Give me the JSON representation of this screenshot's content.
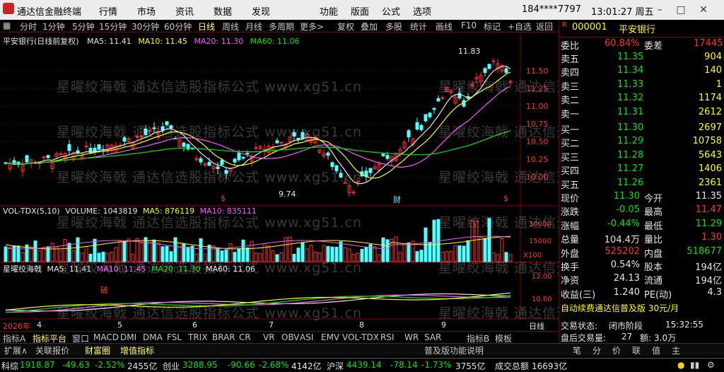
{
  "titlebar": {
    "app_name": "通达信金融终端",
    "menus": [
      "行情",
      "市场",
      "资讯",
      "数据",
      "发现",
      "功能",
      "版面",
      "公式",
      "选项"
    ],
    "user": "184****7797",
    "clock": "13:01:27 周五"
  },
  "toolbar": {
    "periods": [
      "分时",
      "1分钟",
      "5分钟",
      "15分钟",
      "30分钟",
      "60分钟",
      "日线",
      "周线",
      "月线",
      "多周期",
      "更多>"
    ],
    "active_period": "日线",
    "tools": [
      "复权",
      "叠加",
      "多股",
      "统计",
      "画线",
      "F10",
      "标记",
      "+自选",
      "返回"
    ]
  },
  "main_chart": {
    "label": "平安银行(日线前复权)",
    "ma_labels": [
      "MA5: 11.41",
      "MA10: 11.45",
      "MA20: 11.30",
      "MA60: 11.06"
    ],
    "ma_colors": [
      "#e6e6e6",
      "#ffff00",
      "#ff54ff",
      "#00e600"
    ],
    "price_ticks": [
      "11.50",
      "11.25",
      "11.00",
      "10.75",
      "10.50",
      "10.25",
      "10.00"
    ],
    "high_label": "11.83",
    "low_label": "9.74",
    "event_marks": [
      "$",
      "财",
      "$"
    ]
  },
  "volume_chart": {
    "label": "VOL-TDX(5,10)",
    "values": [
      "VOLUME: 1043819",
      "MA5: 876119",
      "MA10: 835111"
    ],
    "ticks": [
      "30000",
      "15000",
      "X100"
    ]
  },
  "indicator_chart": {
    "label": "星曜绞海戟",
    "values": [
      "MA5: 11.41",
      "MA10: 11.45",
      "MA20: 11.30",
      "MA60: 11.06"
    ],
    "ticks": [
      "12.00",
      "10.60"
    ],
    "mark": "破"
  },
  "x_axis": {
    "labels": [
      "2026年",
      "4",
      "5",
      "6",
      "7",
      "8",
      "9"
    ],
    "period_label": "日线"
  },
  "watermark": "星曜绞海戟 通达信选股指标公式 www.xg51.cn",
  "indicator_tabs": [
    "指标A",
    "指标平台",
    "窗口",
    "MACD",
    "DMI",
    "DMA",
    "FSL",
    "TRIX",
    "BRAR",
    "CR",
    "VR",
    "OBV",
    "ASI",
    "EMV",
    "VOL-TDX",
    "RSI",
    "WR",
    "SAR",
    "指标B",
    "模板"
  ],
  "ext_tabs": [
    "扩展∧",
    "关联报价",
    "财富圈",
    "增值指标"
  ],
  "news_ticker": "普及版功能说明",
  "stock": {
    "code": "000001",
    "name": "平安银行"
  },
  "order_book": {
    "weibi_label": "委比",
    "weibi": "60.84%",
    "weicha_label": "委差",
    "weicha": "17445",
    "asks": [
      {
        "label": "卖五",
        "price": "11.35",
        "vol": "904"
      },
      {
        "label": "卖四",
        "price": "11.34",
        "vol": "140"
      },
      {
        "label": "卖三",
        "price": "11.33",
        "vol": "1"
      },
      {
        "label": "卖二",
        "price": "11.32",
        "vol": "1174"
      },
      {
        "label": "卖一",
        "price": "11.31",
        "vol": "2612"
      }
    ],
    "bids": [
      {
        "label": "买一",
        "price": "11.30",
        "vol": "2697"
      },
      {
        "label": "买二",
        "price": "11.29",
        "vol": "10758"
      },
      {
        "label": "买三",
        "price": "11.28",
        "vol": "5643"
      },
      {
        "label": "买四",
        "price": "11.27",
        "vol": "1406"
      },
      {
        "label": "买五",
        "price": "11.26",
        "vol": "2361"
      }
    ]
  },
  "quote": [
    {
      "l1": "现价",
      "v1": "11.30",
      "c1": "green",
      "l2": "今开",
      "v2": "11.35",
      "c2": "white"
    },
    {
      "l1": "涨跌",
      "v1": "-0.05",
      "c1": "green",
      "l2": "最高",
      "v2": "11.47",
      "c2": "red"
    },
    {
      "l1": "涨幅",
      "v1": "-0.44%",
      "c1": "green",
      "l2": "最低",
      "v2": "11.29",
      "c2": "green"
    },
    {
      "l1": "总量",
      "v1": "104.4万",
      "c1": "white",
      "l2": "量比",
      "v2": "1.30",
      "c2": "red"
    },
    {
      "l1": "外盘",
      "v1": "525202",
      "c1": "red",
      "l2": "内盘",
      "v2": "518677",
      "c2": "green"
    }
  ],
  "fundamentals": [
    {
      "l1": "换手",
      "v1": "0.54%",
      "l2": "股本",
      "v2": "194亿"
    },
    {
      "l1": "净资",
      "v1": "24.13",
      "l2": "流通",
      "v2": "194亿"
    },
    {
      "l1": "收益(三)",
      "v1": "1.240",
      "l2": "PE(动)",
      "v2": "4.3"
    }
  ],
  "promo": "自动续费通达信普及版 30元/月",
  "trade_status": {
    "state_label": "交易状态:",
    "state": "闭市阶段",
    "time": "15:32:55",
    "after_label": "盘后交易量:",
    "after_vol": "27",
    "amount_label": "额:",
    "amount": "3.0万"
  },
  "panel_tabs": [
    "笔",
    "分",
    "价",
    "联",
    "值",
    "主"
  ],
  "status_bar": [
    {
      "name": "科综",
      "value": "1918.87",
      "chg": "-49.63",
      "pct": "-2.52%",
      "amt": "2455亿"
    },
    {
      "name": "创业",
      "value": "3288.95",
      "chg": "-90.66",
      "pct": "-2.68%",
      "amt": "4142亿"
    },
    {
      "name": "沪深",
      "value": "4439.14",
      "chg": "-78.14",
      "pct": "-1.73%",
      "amt": "3755亿"
    }
  ],
  "status_extra": {
    "label": "成交总额",
    "value": "16693亿"
  },
  "chart_data": {
    "type": "candlestick",
    "x_axis_labels": [
      "2026年",
      "4",
      "5",
      "6",
      "7",
      "8",
      "9"
    ],
    "y_range": [
      9.7,
      11.85
    ],
    "high_mark": 11.83,
    "low_mark": 9.74,
    "series": [
      {
        "name": "MA5",
        "last": 11.41
      },
      {
        "name": "MA10",
        "last": 11.45
      },
      {
        "name": "MA20",
        "last": 11.3
      },
      {
        "name": "MA60",
        "last": 11.06
      }
    ],
    "volume": {
      "last": 1043819,
      "ma5": 876119,
      "ma10": 835111
    }
  }
}
